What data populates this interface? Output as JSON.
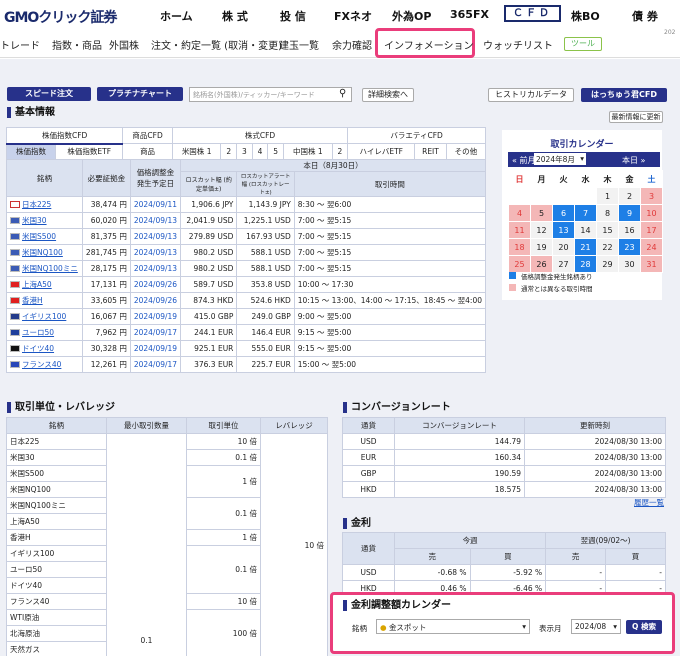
{
  "header": {
    "logo": "GMOクリック証券",
    "nav": [
      "ホーム",
      "株 式",
      "投 信",
      "FXネオ",
      "外為OP",
      "365FX",
      "ＣＦＤ",
      "株BO",
      "債 券"
    ]
  },
  "subnav": {
    "items": [
      "トレード",
      "指数・商品",
      "外国株",
      "注文・約定一覧 (取消・変更)",
      "建玉一覧",
      "余力確認",
      "インフォメーション",
      "ウォッチリスト"
    ],
    "tool": "ツール",
    "page": "202"
  },
  "toolbar": {
    "speed": "スピード注文",
    "platinum": "プラチナチャート",
    "search_placeholder": "銘柄名(外国株)/ティッカー/キーワード",
    "detail_search": "詳細検索へ",
    "historical": "ヒストリカルデータ",
    "hacchu": "はっちゅう君CFD",
    "latest": "最新情報に更新"
  },
  "basic": {
    "title": "基本情報",
    "tabs1": [
      "株価指数CFD",
      "商品CFD",
      "株式CFD",
      "バラエティCFD"
    ],
    "tabs2": [
      "株価指数",
      "株価指数ETF",
      "商品",
      "米国株 1",
      "2",
      "3",
      "4",
      "5",
      "中国株 1",
      "2",
      "ハイレバETF",
      "REIT",
      "その他"
    ],
    "cols": [
      "銘柄",
      "必要証拠金",
      "価格調整金 発生予定日",
      "本日（8月30日）",
      "ロスカット幅 (約定単価±)",
      "ロスカットアラート幅 (ロスカットレート±)",
      "取引時間"
    ],
    "rows": [
      {
        "flag": "jp",
        "name": "日本225",
        "margin": "38,474 円",
        "date": "2024/09/11",
        "lc": "1,906.6 JPY",
        "lca": "1,143.9 JPY",
        "time": "8:30 〜 翌6:00"
      },
      {
        "flag": "us",
        "name": "米国30",
        "margin": "60,020 円",
        "date": "2024/09/13",
        "lc": "2,041.9 USD",
        "lca": "1,225.1 USD",
        "time": "7:00 〜 翌5:15"
      },
      {
        "flag": "us",
        "name": "米国S500",
        "margin": "81,375 円",
        "date": "2024/09/13",
        "lc": "279.89 USD",
        "lca": "167.93 USD",
        "time": "7:00 〜 翌5:15"
      },
      {
        "flag": "us",
        "name": "米国NQ100",
        "margin": "281,745 円",
        "date": "2024/09/13",
        "lc": "980.2 USD",
        "lca": "588.1 USD",
        "time": "7:00 〜 翌5:15"
      },
      {
        "flag": "us",
        "name": "米国NQ100ミニ",
        "margin": "28,175 円",
        "date": "2024/09/13",
        "lc": "980.2 USD",
        "lca": "588.1 USD",
        "time": "7:00 〜 翌5:15"
      },
      {
        "flag": "cn",
        "name": "上海A50",
        "margin": "17,131 円",
        "date": "2024/09/26",
        "lc": "589.7 USD",
        "lca": "353.8 USD",
        "time": "10:00 〜 17:30"
      },
      {
        "flag": "hk",
        "name": "香港H",
        "margin": "33,605 円",
        "date": "2024/09/26",
        "lc": "874.3 HKD",
        "lca": "524.6 HKD",
        "time": "10:15 〜 13:00、14:00 〜 17:15、18:45 〜 翌4:00"
      },
      {
        "flag": "uk",
        "name": "イギリス100",
        "margin": "16,067 円",
        "date": "2024/09/19",
        "lc": "415.0 GBP",
        "lca": "249.0 GBP",
        "time": "9:00 〜 翌5:00"
      },
      {
        "flag": "eu",
        "name": "ユーロ50",
        "margin": "7,962 円",
        "date": "2024/09/17",
        "lc": "244.1 EUR",
        "lca": "146.4 EUR",
        "time": "9:15 〜 翌5:00"
      },
      {
        "flag": "de",
        "name": "ドイツ40",
        "margin": "30,328 円",
        "date": "2024/09/19",
        "lc": "925.1 EUR",
        "lca": "555.0 EUR",
        "time": "9:15 〜 翌5:00"
      },
      {
        "flag": "fr",
        "name": "フランス40",
        "margin": "12,261 円",
        "date": "2024/09/17",
        "lc": "376.3 EUR",
        "lca": "225.7 EUR",
        "time": "15:00 〜 翌5:00"
      }
    ]
  },
  "calendar": {
    "title": "取引カレンダー",
    "prev": "前月",
    "month": "2024年8月",
    "next": "本日",
    "weekdays": [
      "日",
      "月",
      "火",
      "水",
      "木",
      "金",
      "土"
    ],
    "weeks": [
      [
        "",
        "",
        "",
        "",
        "1",
        "2",
        "3"
      ],
      [
        "4",
        "5",
        "6",
        "7",
        "8",
        "9",
        "10"
      ],
      [
        "11",
        "12",
        "13",
        "14",
        "15",
        "16",
        "17"
      ],
      [
        "18",
        "19",
        "20",
        "21",
        "22",
        "23",
        "24"
      ],
      [
        "25",
        "26",
        "27",
        "28",
        "29",
        "30",
        "31"
      ]
    ],
    "blue": [
      "6",
      "7",
      "9",
      "13",
      "21",
      "23",
      "28"
    ],
    "pink": [
      "5",
      "26",
      "3",
      "10",
      "17",
      "24",
      "31",
      "4",
      "11",
      "18",
      "25"
    ],
    "legend1": "価格調整金発生銘柄あり",
    "legend2": "通常とは異なる取引時間"
  },
  "leverage": {
    "title": "取引単位・レバレッジ",
    "cols": [
      "銘柄",
      "最小取引数量",
      "取引単位",
      "レバレッジ"
    ],
    "names": [
      "日本225",
      "米国30",
      "米国S500",
      "米国NQ100",
      "米国NQ100ミニ",
      "上海A50",
      "香港H",
      "イギリス100",
      "ユーロ50",
      "ドイツ40",
      "フランス40",
      "WTI原油",
      "北海原油",
      "天然ガス"
    ],
    "units": [
      "10 倍",
      "0.1 倍",
      "1 倍",
      "0.1 倍",
      "1 倍",
      "0.1 倍",
      "10 倍",
      "100 倍"
    ],
    "min_qty": "0.1",
    "lev": "10 倍"
  },
  "conversion": {
    "title": "コンバージョンレート",
    "cols": [
      "通貨",
      "コンバージョンレート",
      "更新時刻"
    ],
    "rows": [
      {
        "cur": "USD",
        "rate": "144.79",
        "time": "2024/08/30 13:00"
      },
      {
        "cur": "EUR",
        "rate": "160.34",
        "time": "2024/08/30 13:00"
      },
      {
        "cur": "GBP",
        "rate": "190.59",
        "time": "2024/08/30 13:00"
      },
      {
        "cur": "HKD",
        "rate": "18.575",
        "time": "2024/08/30 13:00"
      }
    ],
    "history": "履歴一覧"
  },
  "interest": {
    "title": "金利",
    "cols": [
      "通貨",
      "今週",
      "翌週(09/02〜)",
      "売",
      "買",
      "売",
      "買"
    ],
    "rows": [
      {
        "cur": "USD",
        "s1": "-0.68 %",
        "b1": "-5.92 %",
        "s2": "-",
        "b2": "-"
      },
      {
        "cur": "HKD",
        "s1": "0.46 %",
        "b1": "-6.46 %",
        "s2": "-",
        "b2": "-"
      }
    ]
  },
  "kinri": {
    "title": "金利調整額カレンダー",
    "label": "銘柄",
    "symbol": "金スポット",
    "month_label": "表示月",
    "month": "2024/08",
    "search": "検索"
  }
}
